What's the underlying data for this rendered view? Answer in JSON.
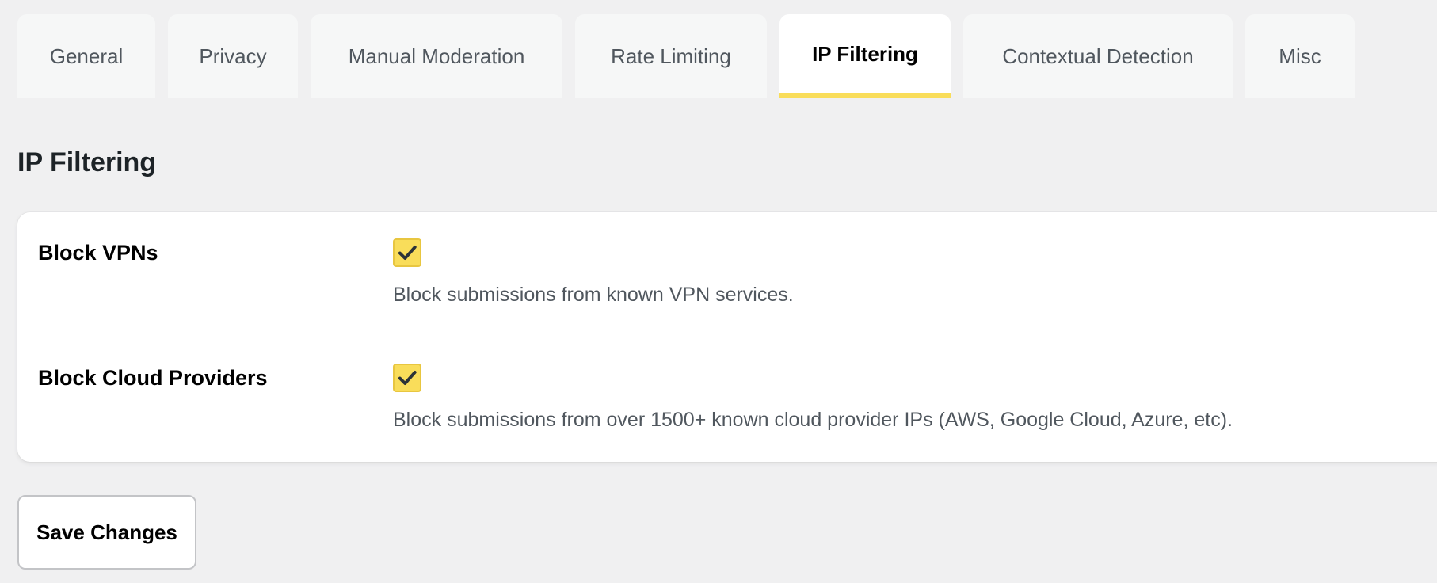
{
  "tabs": [
    {
      "label": "General",
      "active": false
    },
    {
      "label": "Privacy",
      "active": false
    },
    {
      "label": "Manual Moderation",
      "active": false
    },
    {
      "label": "Rate Limiting",
      "active": false
    },
    {
      "label": "IP Filtering",
      "active": true
    },
    {
      "label": "Contextual Detection",
      "active": false
    },
    {
      "label": "Misc",
      "active": false
    }
  ],
  "section": {
    "title": "IP Filtering"
  },
  "settings": [
    {
      "label": "Block VPNs",
      "checked": true,
      "description": "Block submissions from known VPN services."
    },
    {
      "label": "Block Cloud Providers",
      "checked": true,
      "description": "Block submissions from over 1500+ known cloud provider IPs (AWS, Google Cloud, Azure, etc)."
    }
  ],
  "actions": {
    "save_label": "Save Changes"
  },
  "colors": {
    "accent": "#f9dd5a",
    "background": "#f0f0f1",
    "tab_inactive": "#f6f7f7",
    "card": "#ffffff"
  },
  "icons": {
    "checkbox": "checkmark-icon"
  }
}
